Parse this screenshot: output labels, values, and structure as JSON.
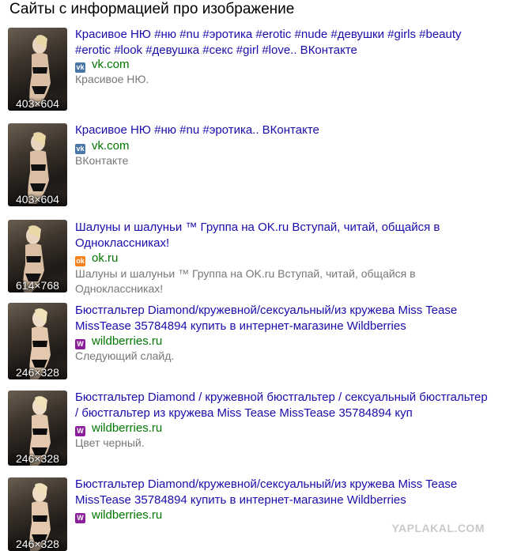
{
  "heading": "Сайты с информацией про изображение",
  "results": [
    {
      "dims": "403×604",
      "title_lines": [
        "Красивое НЮ #ню #nu #эротика #erotic #nude #девушки #girls #beauty",
        "#erotic #look #девушка #секс #girl #love.. ВКонтакте"
      ],
      "favicon": "vk-icon",
      "site": "vk.com",
      "snippet_lines": [
        "Красивое НЮ."
      ]
    },
    {
      "dims": "403×604",
      "title_lines": [
        "Красивое НЮ #ню #nu #эротика.. ВКонтакте"
      ],
      "favicon": "vk-icon",
      "site": "vk.com",
      "snippet_lines": [
        "ВКонтакте"
      ]
    },
    {
      "dims": "614×768",
      "title_lines": [
        "Шалуны и шалуньи ™ Группа на OK.ru Вступай, читай, общайся в",
        "Одноклассниках!"
      ],
      "favicon": "ok-icon",
      "site": "ok.ru",
      "snippet_lines": [
        "Шалуны и шалуньи ™ Группа на OK.ru Вступай, читай, общайся в",
        "Одноклассниках!"
      ]
    },
    {
      "dims": "246×328",
      "title_lines": [
        "Бюстгальтер Diamond/кружевной/сексуальный/из кружева Miss Tease",
        "MissTease 35784894 купить в интернет-магазине Wildberries"
      ],
      "favicon": "wildberries-icon",
      "site": "wildberries.ru",
      "snippet_lines": [
        "Следующий слайд."
      ]
    },
    {
      "dims": "246×328",
      "title_lines": [
        "Бюстгальтер Diamond / кружевной бюстгальтер / сексуальный бюстгальтер",
        "/ бюстгальтер из кружева Miss Tease MissTease 35784894 куп"
      ],
      "favicon": "wildberries-icon",
      "site": "wildberries.ru",
      "snippet_lines": [
        "Цвет черный."
      ]
    },
    {
      "dims": "246×328",
      "title_lines": [
        "Бюстгальтер Diamond/кружевной/сексуальный/из кружева Miss Tease",
        "MissTease 35784894 купить в интернет-магазине Wildberries"
      ],
      "favicon": "wildberries-icon",
      "site": "wildberries.ru",
      "snippet_lines": []
    }
  ],
  "watermark": "YAPLAKAL.COM",
  "colors": {
    "title": "#1a0dab",
    "site": "#007700",
    "snippet": "#777777",
    "vk": "#4a76a8",
    "ok": "#f58220",
    "wildberries": "#8b1f9a"
  }
}
